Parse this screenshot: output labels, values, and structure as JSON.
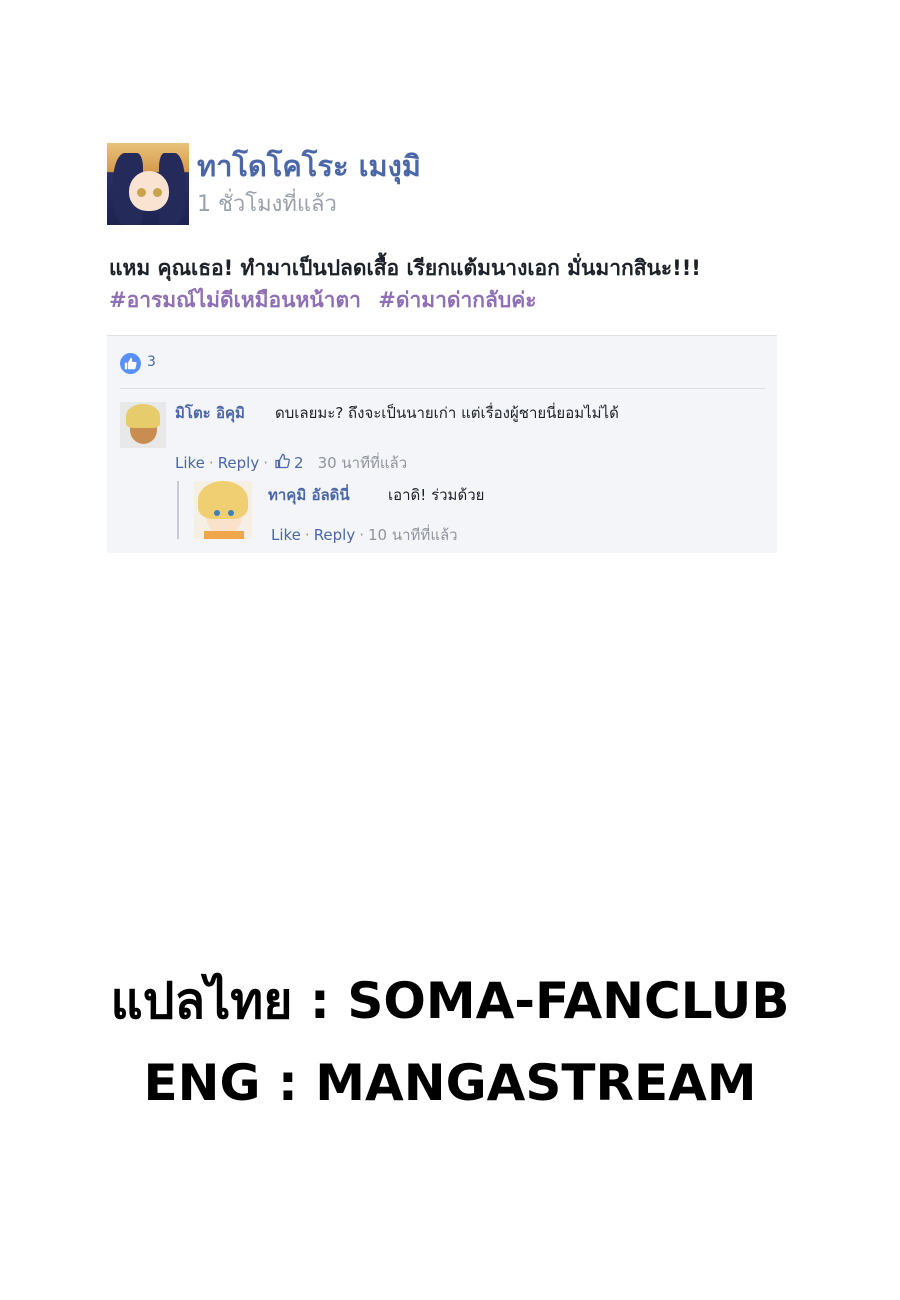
{
  "post": {
    "author_name": "ทาโดโคโระ เมงุมิ",
    "time": "1 ชั่วโมงที่แล้ว",
    "text": "แหม คุณเธอ! ทำมาเป็นปลดเสื้อ เรียกแต้มนางเอก มั่นมากสินะ!!!",
    "hashtags": [
      "#อารมณ์ไม่ดีเหมือนหน้าตา",
      "#ด่ามาด่ากลับค่ะ"
    ],
    "like_count": "3"
  },
  "comments": [
    {
      "author_name": "มิโตะ อิคุมิ",
      "text": "ดบเลยมะ? ถึงจะเป็นนายเก่า แต่เรื่องผู้ชายนี่ยอมไม่ได้",
      "like_label": "Like",
      "reply_label": "Reply",
      "likes": "2",
      "time": "30 นาทีที่แล้ว"
    },
    {
      "author_name": "ทาคุมิ อัลดินี่",
      "text": "เอาดิ! ร่วมด้วย",
      "like_label": "Like",
      "reply_label": "Reply",
      "time": "10 นาทีที่แล้ว"
    }
  ],
  "credits": {
    "thai": "แปลไทย : SOMA-FANCLUB",
    "eng": "ENG : MANGASTREAM"
  },
  "colors": {
    "link_blue": "#4b67a8",
    "hashtag_purple": "#8f6fb5",
    "gray_text": "#90949c",
    "comment_bg": "#f4f5f8"
  }
}
